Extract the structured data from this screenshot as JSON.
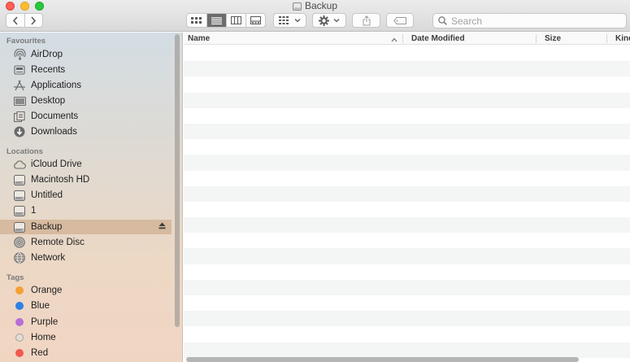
{
  "window": {
    "title": "Backup"
  },
  "toolbar": {
    "search_placeholder": "Search",
    "active_view": "list"
  },
  "sidebar": {
    "sections": [
      {
        "label": "Favourites",
        "items": [
          {
            "label": "AirDrop",
            "icon": "airdrop-icon"
          },
          {
            "label": "Recents",
            "icon": "recents-icon"
          },
          {
            "label": "Applications",
            "icon": "applications-icon"
          },
          {
            "label": "Desktop",
            "icon": "desktop-icon"
          },
          {
            "label": "Documents",
            "icon": "documents-icon"
          },
          {
            "label": "Downloads",
            "icon": "downloads-icon"
          }
        ]
      },
      {
        "label": "Locations",
        "items": [
          {
            "label": "iCloud Drive",
            "icon": "icloud-icon"
          },
          {
            "label": "Macintosh HD",
            "icon": "disk-icon"
          },
          {
            "label": "Untitled",
            "icon": "disk-icon"
          },
          {
            "label": "1",
            "icon": "disk-icon"
          },
          {
            "label": "Backup",
            "icon": "disk-icon",
            "selected": true
          },
          {
            "label": "Remote Disc",
            "icon": "remote-disc-icon"
          },
          {
            "label": "Network",
            "icon": "network-icon"
          }
        ]
      },
      {
        "label": "Tags",
        "items": [
          {
            "label": "Orange",
            "color": "#f5a033"
          },
          {
            "label": "Blue",
            "color": "#2f7fe6"
          },
          {
            "label": "Purple",
            "color": "#b56fd6"
          },
          {
            "label": "Home",
            "color": "#d6d6d6"
          },
          {
            "label": "Red",
            "color": "#f05a4f"
          }
        ]
      }
    ]
  },
  "list": {
    "columns": [
      {
        "label": "Name",
        "sorted": "ascending"
      },
      {
        "label": "Date Modified"
      },
      {
        "label": "Size"
      },
      {
        "label": "Kind"
      }
    ]
  },
  "colors": {
    "selection": "#c4966e",
    "close": "#fe5f57",
    "minimize": "#febc2e",
    "maximize": "#28c840"
  }
}
